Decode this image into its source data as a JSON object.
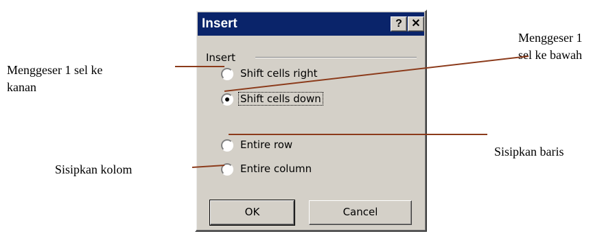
{
  "dialog": {
    "title": "Insert",
    "help_label": "?",
    "close_label": "✕",
    "group_label": "Insert",
    "options": [
      {
        "label": "Shift cells right",
        "selected": false
      },
      {
        "label": "Shift cells down",
        "selected": true
      },
      {
        "label": "Entire row",
        "selected": false
      },
      {
        "label": "Entire column",
        "selected": false
      }
    ],
    "ok_label": "OK",
    "cancel_label": "Cancel"
  },
  "annotations": {
    "shift_right_line1": "Menggeser 1 sel ke",
    "shift_right_line2": "kanan",
    "shift_down_line1": "Menggeser 1",
    "shift_down_line2": "sel ke bawah",
    "entire_row": "Sisipkan baris",
    "entire_column": "Sisipkan kolom"
  },
  "colors": {
    "titlebar": "#0a246a",
    "dialog_face": "#d4d0c8",
    "pointer_line": "#8b3a1a"
  }
}
